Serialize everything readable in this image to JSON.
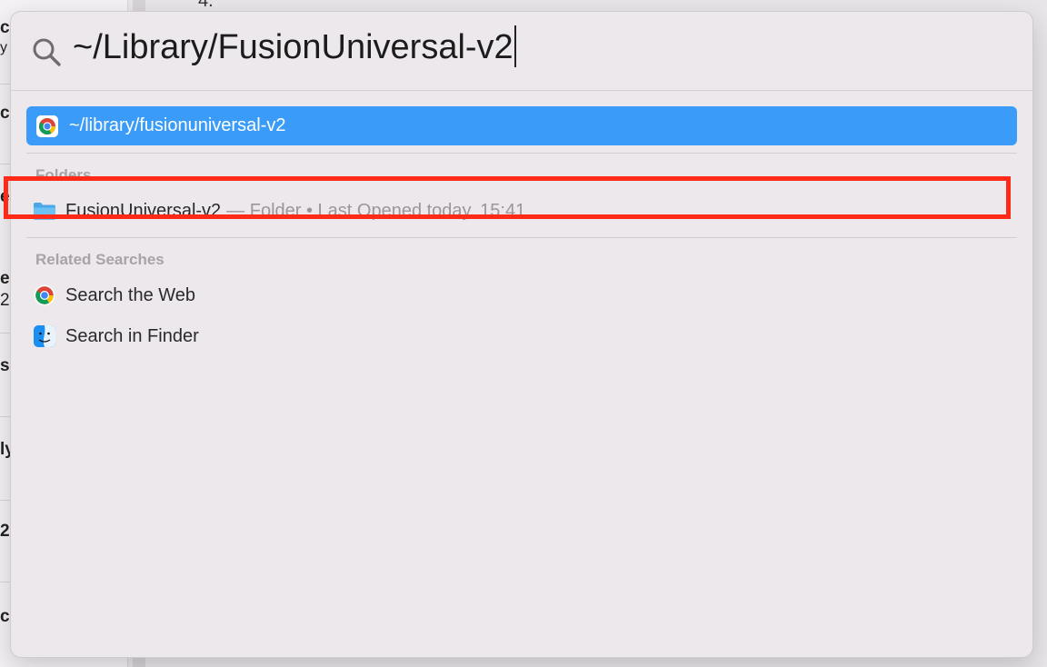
{
  "background": {
    "left_fragments": [
      "c",
      "y",
      "c",
      "es",
      "e",
      "2",
      "se",
      "ly",
      "2",
      "c"
    ],
    "list_number": "4."
  },
  "spotlight": {
    "query": "~/Library/FusionUniversal-v2",
    "top_hit": {
      "label": "~/library/fusionuniversal-v2",
      "icon": "chrome-icon"
    },
    "sections": {
      "folders": {
        "title": "Folders",
        "items": [
          {
            "name": "FusionUniversal-v2",
            "meta": "— Folder • Last Opened today, 15:41",
            "icon": "folder-icon"
          }
        ]
      },
      "related": {
        "title": "Related Searches",
        "items": [
          {
            "name": "Search the Web",
            "icon": "chrome-icon"
          },
          {
            "name": "Search in Finder",
            "icon": "finder-icon"
          }
        ]
      }
    }
  },
  "colors": {
    "selection": "#3a9cf8",
    "annotation_box": "#ff2a17",
    "panel": "#ece8ec"
  }
}
